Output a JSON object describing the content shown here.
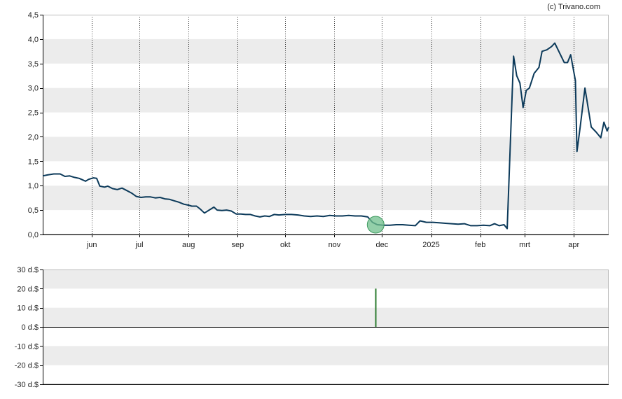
{
  "credit": "(c) Trivano.com",
  "colors": {
    "line": "#0c3a5a",
    "band": "#ececec",
    "frame": "#000000",
    "marker_fill": "#6fbf8c",
    "marker_stroke": "#3e9a5f",
    "bar": "#2e7d32"
  },
  "chart_data": [
    {
      "type": "line",
      "title": "",
      "xlabel": "",
      "ylabel": "",
      "ylim": [
        0,
        4.5
      ],
      "y_ticks": [
        "0,0",
        "0,5",
        "1,0",
        "1,5",
        "2,0",
        "2,5",
        "3,0",
        "3,5",
        "4,0",
        "4,5"
      ],
      "x_ticks": [
        "jun",
        "jul",
        "aug",
        "sep",
        "okt",
        "nov",
        "dec",
        "2025",
        "feb",
        "mrt",
        "apr"
      ],
      "grid": "alternating horizontal bands, dotted vertical lines at month starts",
      "x_axis": "dates from 2024-05-01 to 2025-04-23",
      "series": [
        {
          "values": [
            [
              "2024-05-01",
              1.2
            ],
            [
              "2024-05-04",
              1.22
            ],
            [
              "2024-05-08",
              1.24
            ],
            [
              "2024-05-12",
              1.24
            ],
            [
              "2024-05-15",
              1.19
            ],
            [
              "2024-05-18",
              1.2
            ],
            [
              "2024-05-21",
              1.17
            ],
            [
              "2024-05-24",
              1.15
            ],
            [
              "2024-05-26",
              1.12
            ],
            [
              "2024-05-28",
              1.09
            ],
            [
              "2024-05-30",
              1.13
            ],
            [
              "2024-06-02",
              1.16
            ],
            [
              "2024-06-04",
              1.15
            ],
            [
              "2024-06-06",
              0.99
            ],
            [
              "2024-06-09",
              0.97
            ],
            [
              "2024-06-11",
              0.99
            ],
            [
              "2024-06-14",
              0.94
            ],
            [
              "2024-06-17",
              0.92
            ],
            [
              "2024-06-20",
              0.95
            ],
            [
              "2024-06-23",
              0.9
            ],
            [
              "2024-06-26",
              0.85
            ],
            [
              "2024-06-29",
              0.78
            ],
            [
              "2024-07-02",
              0.76
            ],
            [
              "2024-07-05",
              0.77
            ],
            [
              "2024-07-08",
              0.77
            ],
            [
              "2024-07-11",
              0.75
            ],
            [
              "2024-07-14",
              0.76
            ],
            [
              "2024-07-17",
              0.73
            ],
            [
              "2024-07-20",
              0.72
            ],
            [
              "2024-07-23",
              0.69
            ],
            [
              "2024-07-26",
              0.66
            ],
            [
              "2024-07-29",
              0.62
            ],
            [
              "2024-08-01",
              0.6
            ],
            [
              "2024-08-03",
              0.58
            ],
            [
              "2024-08-06",
              0.58
            ],
            [
              "2024-08-08",
              0.53
            ],
            [
              "2024-08-11",
              0.44
            ],
            [
              "2024-08-14",
              0.5
            ],
            [
              "2024-08-17",
              0.56
            ],
            [
              "2024-08-19",
              0.5
            ],
            [
              "2024-08-22",
              0.49
            ],
            [
              "2024-08-25",
              0.5
            ],
            [
              "2024-08-28",
              0.48
            ],
            [
              "2024-08-31",
              0.42
            ],
            [
              "2024-09-03",
              0.42
            ],
            [
              "2024-09-06",
              0.41
            ],
            [
              "2024-09-09",
              0.41
            ],
            [
              "2024-09-12",
              0.38
            ],
            [
              "2024-09-15",
              0.36
            ],
            [
              "2024-09-18",
              0.38
            ],
            [
              "2024-09-21",
              0.37
            ],
            [
              "2024-09-24",
              0.41
            ],
            [
              "2024-09-27",
              0.4
            ],
            [
              "2024-10-01",
              0.41
            ],
            [
              "2024-10-05",
              0.41
            ],
            [
              "2024-10-09",
              0.4
            ],
            [
              "2024-10-13",
              0.38
            ],
            [
              "2024-10-17",
              0.37
            ],
            [
              "2024-10-21",
              0.38
            ],
            [
              "2024-10-25",
              0.37
            ],
            [
              "2024-10-29",
              0.39
            ],
            [
              "2024-11-02",
              0.38
            ],
            [
              "2024-11-06",
              0.38
            ],
            [
              "2024-11-10",
              0.39
            ],
            [
              "2024-11-14",
              0.38
            ],
            [
              "2024-11-18",
              0.38
            ],
            [
              "2024-11-22",
              0.36
            ],
            [
              "2024-11-25",
              0.25
            ],
            [
              "2024-11-28",
              0.2
            ],
            [
              "2024-12-02",
              0.19
            ],
            [
              "2024-12-06",
              0.19
            ],
            [
              "2024-12-10",
              0.2
            ],
            [
              "2024-12-14",
              0.2
            ],
            [
              "2024-12-18",
              0.19
            ],
            [
              "2024-12-22",
              0.18
            ],
            [
              "2024-12-25",
              0.28
            ],
            [
              "2024-12-29",
              0.25
            ],
            [
              "2025-01-02",
              0.25
            ],
            [
              "2025-01-06",
              0.24
            ],
            [
              "2025-01-10",
              0.23
            ],
            [
              "2025-01-14",
              0.22
            ],
            [
              "2025-01-18",
              0.21
            ],
            [
              "2025-01-22",
              0.22
            ],
            [
              "2025-01-26",
              0.18
            ],
            [
              "2025-01-30",
              0.18
            ],
            [
              "2025-02-03",
              0.19
            ],
            [
              "2025-02-07",
              0.18
            ],
            [
              "2025-02-10",
              0.22
            ],
            [
              "2025-02-13",
              0.18
            ],
            [
              "2025-02-16",
              0.2
            ],
            [
              "2025-02-18",
              0.12
            ],
            [
              "2025-02-22",
              3.65
            ],
            [
              "2025-02-24",
              3.25
            ],
            [
              "2025-02-26",
              3.1
            ],
            [
              "2025-02-28",
              2.6
            ],
            [
              "2025-03-02",
              2.95
            ],
            [
              "2025-03-04",
              3.0
            ],
            [
              "2025-03-07",
              3.3
            ],
            [
              "2025-03-10",
              3.42
            ],
            [
              "2025-03-12",
              3.75
            ],
            [
              "2025-03-15",
              3.78
            ],
            [
              "2025-03-18",
              3.85
            ],
            [
              "2025-03-20",
              3.92
            ],
            [
              "2025-03-23",
              3.72
            ],
            [
              "2025-03-26",
              3.52
            ],
            [
              "2025-03-28",
              3.52
            ],
            [
              "2025-03-30",
              3.68
            ],
            [
              "2025-04-02",
              3.15
            ],
            [
              "2025-04-03",
              1.7
            ],
            [
              "2025-04-05",
              2.2
            ],
            [
              "2025-04-08",
              3.0
            ],
            [
              "2025-04-10",
              2.6
            ],
            [
              "2025-04-12",
              2.2
            ],
            [
              "2025-04-15",
              2.1
            ],
            [
              "2025-04-18",
              1.98
            ],
            [
              "2025-04-20",
              2.3
            ],
            [
              "2025-04-22",
              2.12
            ],
            [
              "2025-04-23",
              2.2
            ]
          ]
        }
      ],
      "annotations": [
        {
          "type": "marker",
          "x": "2024-11-27",
          "y": 0.2
        }
      ]
    },
    {
      "type": "bar",
      "title": "",
      "xlabel": "",
      "ylabel": "",
      "ylim": [
        -30,
        30
      ],
      "y_ticks": [
        "30 d.$",
        "20 d.$",
        "10 d.$",
        "0 d.$",
        "-10 d.$",
        "-20 d.$",
        "-30 d.$"
      ],
      "grid": "alternating horizontal bands",
      "x_axis": "dates from 2024-05-01 to 2025-04-23",
      "series": [
        {
          "values": [
            [
              "2024-11-27",
              20
            ]
          ]
        }
      ]
    }
  ]
}
